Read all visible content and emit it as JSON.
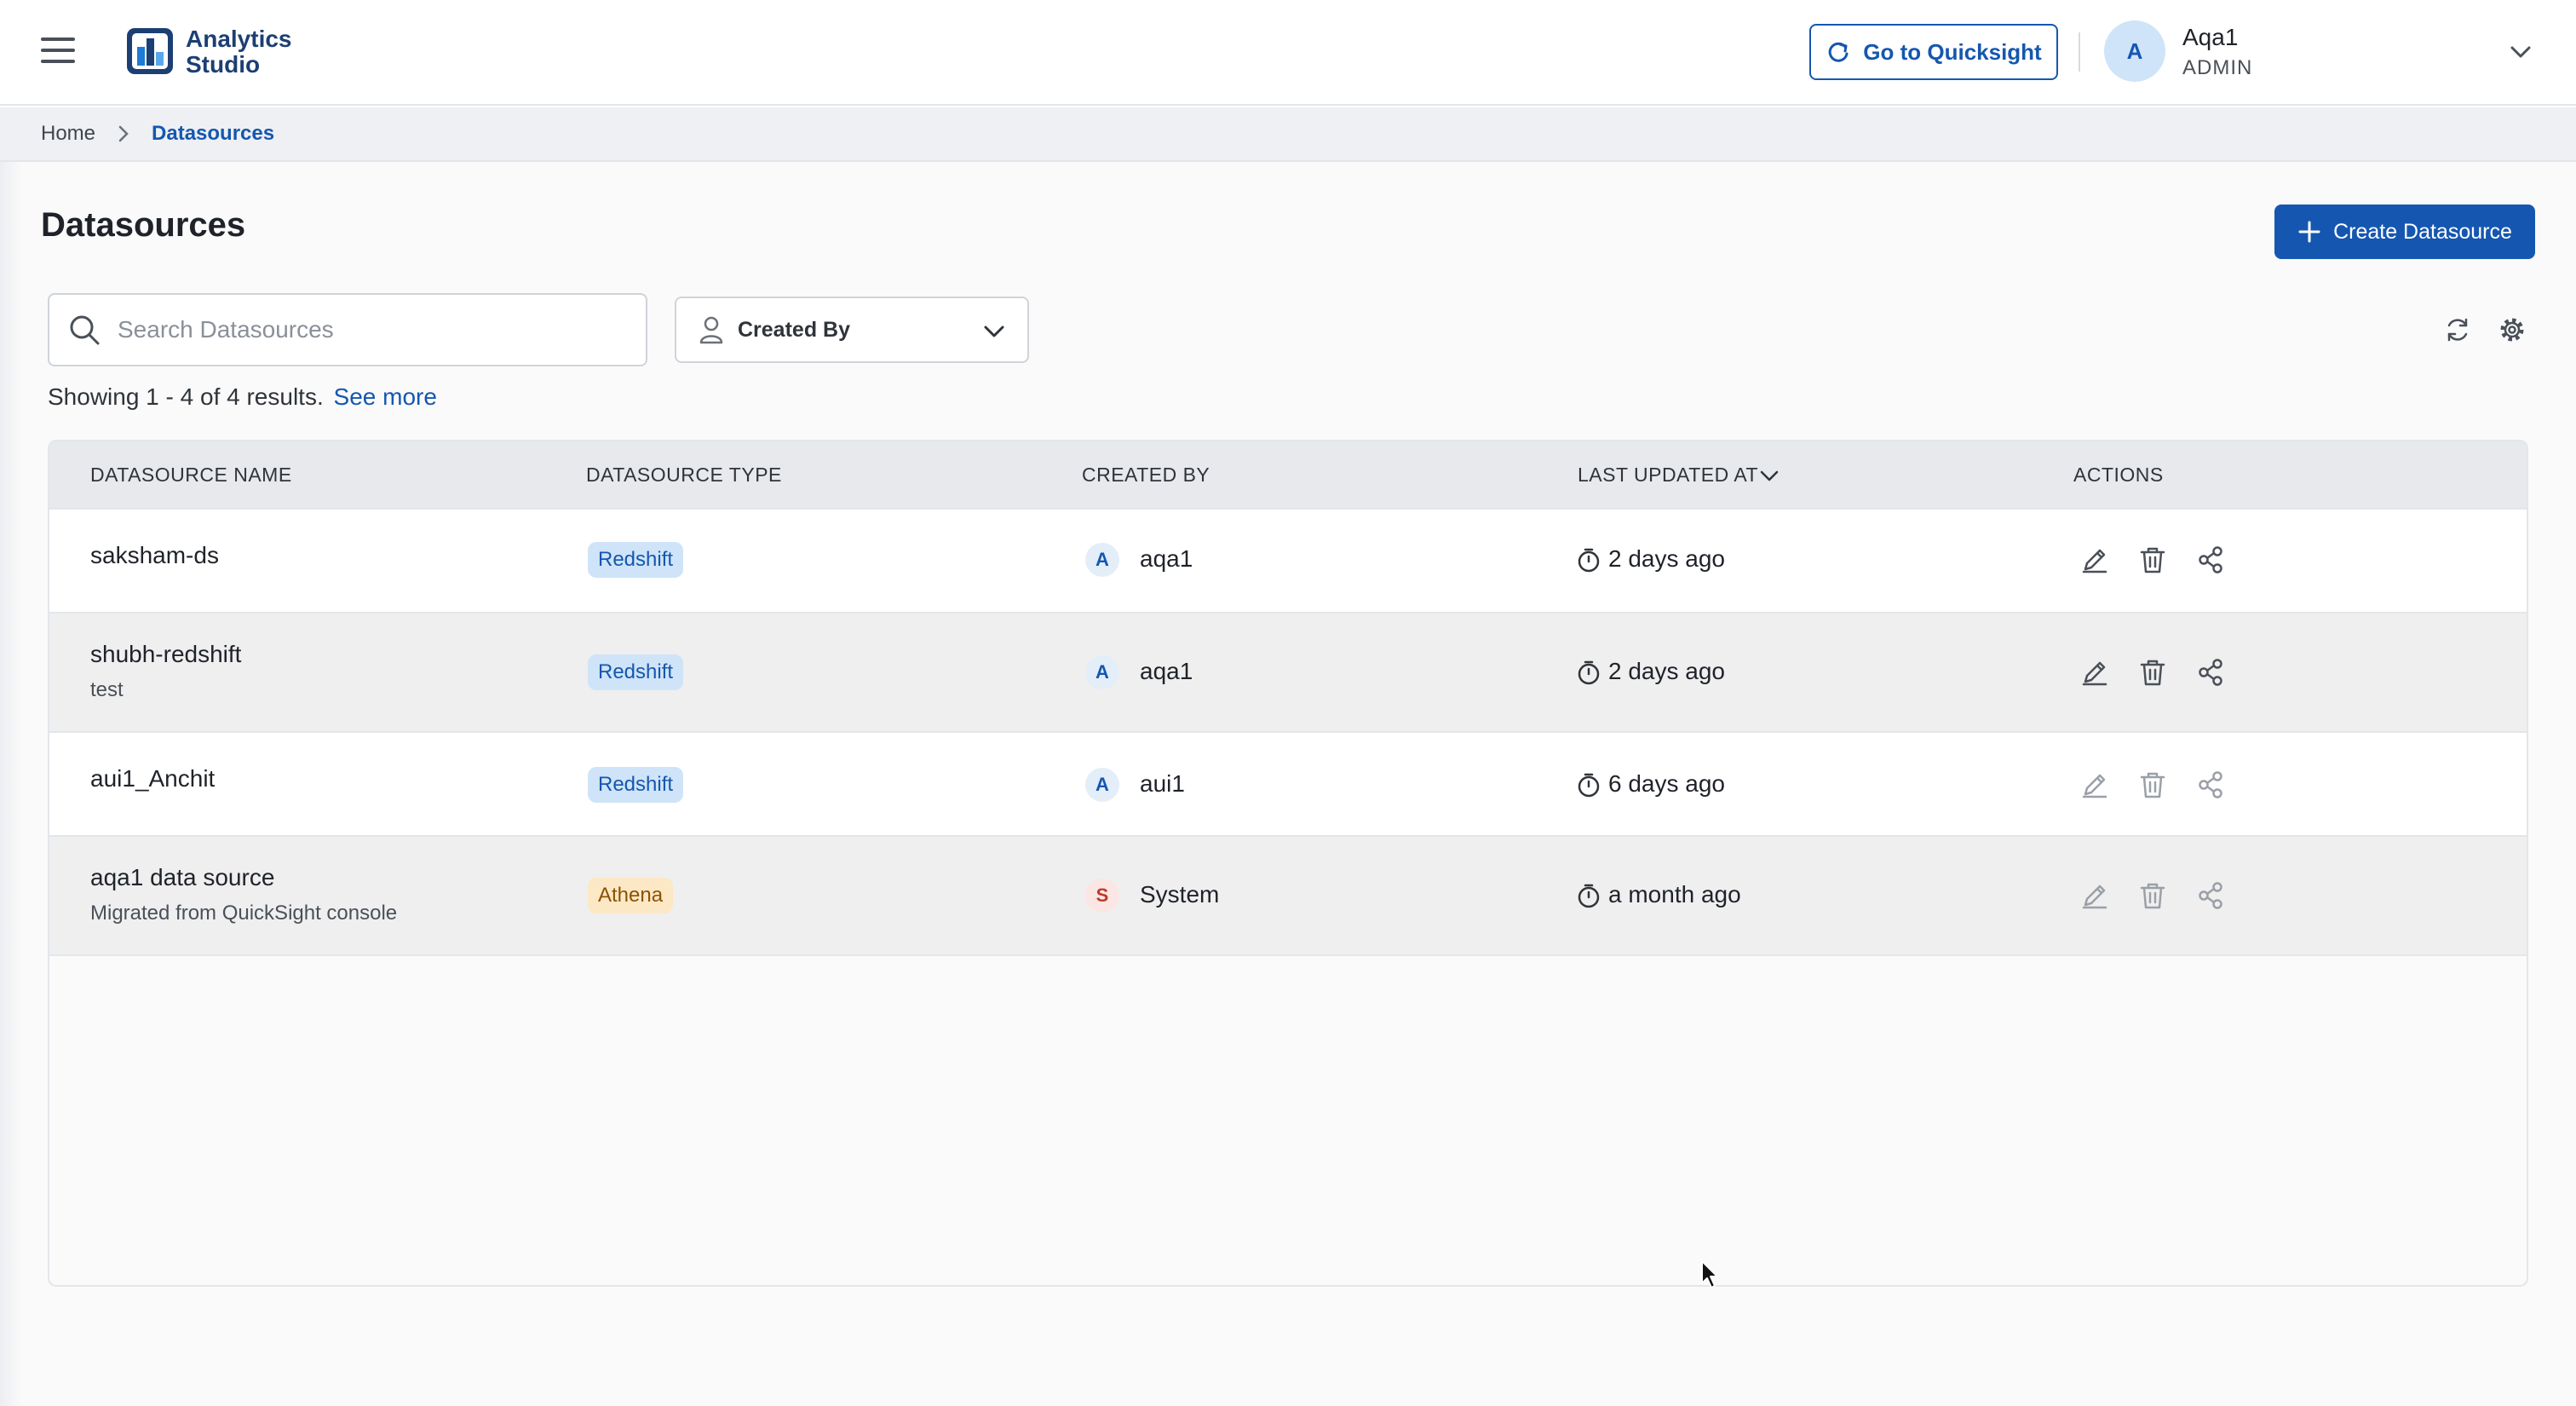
{
  "header": {
    "app_name_line1": "Analytics",
    "app_name_line2": "Studio",
    "quicksight_button": "Go to Quicksight",
    "user": {
      "initial": "A",
      "name": "Aqa1",
      "role": "ADMIN"
    }
  },
  "breadcrumb": {
    "home": "Home",
    "current": "Datasources"
  },
  "page": {
    "title": "Datasources",
    "create_button": "Create Datasource",
    "search_placeholder": "Search Datasources",
    "created_by_filter": "Created By",
    "results_text": "Showing 1 - 4 of 4 results.",
    "see_more": "See more"
  },
  "table": {
    "columns": [
      "DATASOURCE NAME",
      "DATASOURCE TYPE",
      "CREATED BY",
      "LAST UPDATED AT",
      "ACTIONS"
    ],
    "rows": [
      {
        "name": "saksham-ds",
        "description": "",
        "type": "Redshift",
        "creator_initial": "A",
        "creator": "aqa1",
        "updated": "2 days ago"
      },
      {
        "name": "shubh-redshift",
        "description": "test",
        "type": "Redshift",
        "creator_initial": "A",
        "creator": "aqa1",
        "updated": "2 days ago"
      },
      {
        "name": "aui1_Anchit",
        "description": "",
        "type": "Redshift",
        "creator_initial": "A",
        "creator": "aui1",
        "updated": "6 days ago"
      },
      {
        "name": "aqa1 data source",
        "description": "Migrated from QuickSight console",
        "type": "Athena",
        "creator_initial": "S",
        "creator": "System",
        "updated": "a month ago"
      }
    ]
  },
  "colors": {
    "primary": "#1557b0",
    "redshift_badge": "#cfe4f8",
    "athena_badge": "#fde8c6"
  },
  "icons": [
    "menu-icon",
    "logo-icon",
    "sync-icon",
    "chevron-down-icon",
    "chevron-right-icon",
    "plus-icon",
    "search-icon",
    "user-icon",
    "refresh-icon",
    "gear-icon",
    "clock-icon",
    "edit-icon",
    "delete-icon",
    "share-icon"
  ]
}
